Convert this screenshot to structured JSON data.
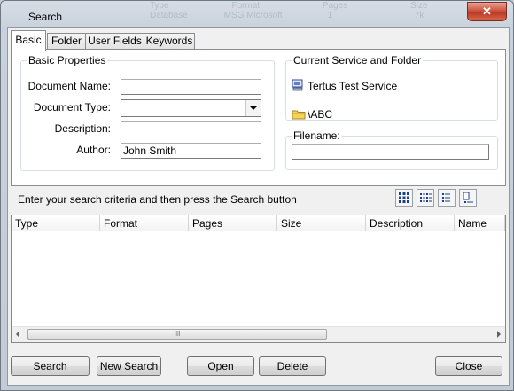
{
  "window": {
    "title": "Search",
    "close_glyph": "✕",
    "background_columns": [
      "Type",
      "Format",
      "Pages",
      "Size"
    ],
    "background_row": [
      "Database",
      "MSG Microsoft",
      "1",
      "7k"
    ]
  },
  "tabs": [
    {
      "label": "Basic",
      "active": true
    },
    {
      "label": "Folder",
      "active": false
    },
    {
      "label": "User Fields",
      "active": false
    },
    {
      "label": "Keywords",
      "active": false
    }
  ],
  "basic_properties": {
    "legend": "Basic Properties",
    "document_name_label": "Document Name:",
    "document_name_value": "",
    "document_type_label": "Document Type:",
    "document_type_value": "",
    "description_label": "Description:",
    "description_value": "",
    "author_label": "Author:",
    "author_value": "John Smith"
  },
  "current_service": {
    "legend": "Current Service and Folder",
    "service_icon": "computer-icon",
    "service_name": "Tertus Test Service",
    "folder_icon": "folder-icon",
    "folder_path": "\\ABC"
  },
  "filename": {
    "legend": "Filename:",
    "value": ""
  },
  "instructions": "Enter your search criteria and then press the Search button",
  "view_buttons": [
    "large-icons-view-icon",
    "small-icons-view-icon",
    "list-view-icon",
    "details-view-icon"
  ],
  "results": {
    "columns": [
      "Type",
      "Format",
      "Pages",
      "Size",
      "Description",
      "Name"
    ],
    "rows": [],
    "scroll_grip": "III"
  },
  "buttons": {
    "search": "Search",
    "new_search": "New Search",
    "open": "Open",
    "delete": "Delete",
    "close": "Close"
  }
}
